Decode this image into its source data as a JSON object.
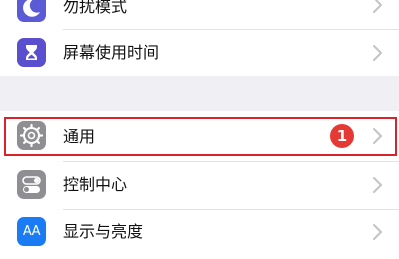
{
  "settings": {
    "items": [
      {
        "label": "勿扰模式",
        "icon": "moon-icon",
        "color": "#5b5bd6"
      },
      {
        "label": "屏幕使用时间",
        "icon": "hourglass-icon",
        "color": "#5a4fcf"
      },
      {
        "label": "通用",
        "icon": "gear-icon",
        "color": "#8e8e93",
        "badge": "1",
        "badge_color": "#e53935"
      },
      {
        "label": "控制中心",
        "icon": "switches-icon",
        "color": "#8e8e93"
      },
      {
        "label": "显示与亮度",
        "icon": "aa-icon",
        "icon_text": "AA",
        "color": "#1a7cf5"
      }
    ]
  },
  "highlight_color": "#d8232a"
}
